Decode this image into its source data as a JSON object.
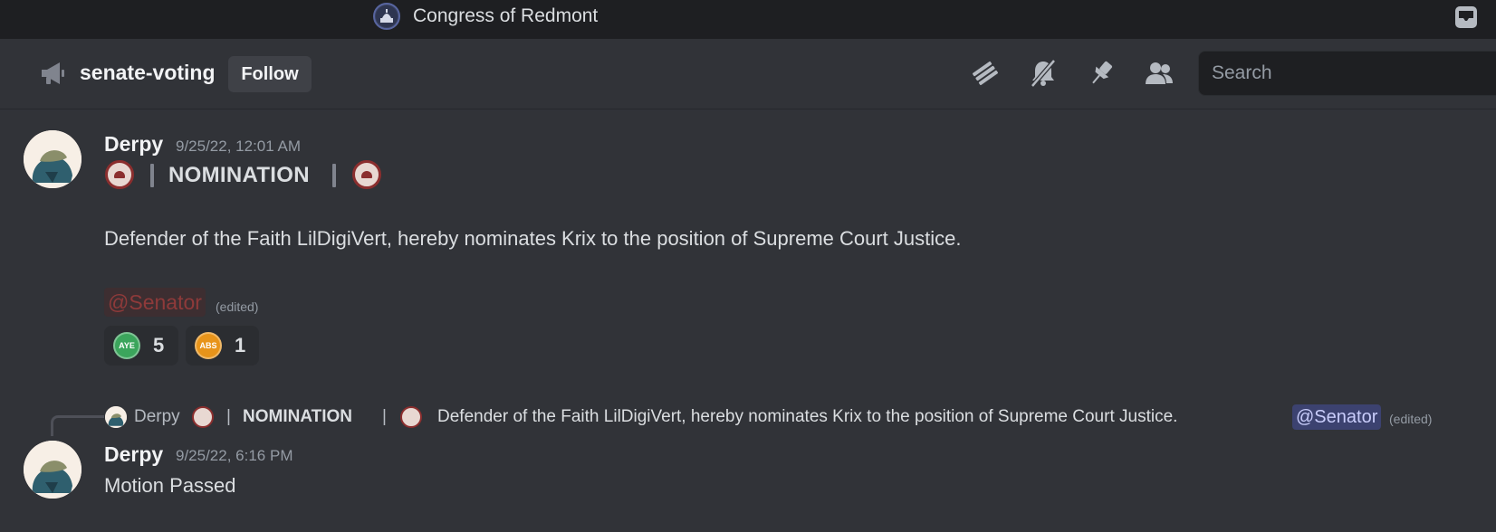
{
  "titlebar": {
    "server_name": "Congress of Redmont",
    "server_icon": "capitol-icon",
    "inbox_icon": "inbox-icon"
  },
  "channel": {
    "icon": "megaphone-icon",
    "name": "senate-voting",
    "follow_label": "Follow",
    "toolbar_icons": [
      "threads-icon",
      "notifications-muted-icon",
      "pin-icon",
      "members-icon"
    ],
    "search_placeholder": "Search"
  },
  "messages": [
    {
      "author": "Derpy",
      "timestamp": "9/25/22, 12:01 AM",
      "heading": "NOMINATION",
      "separator": "|",
      "body": "Defender of the Faith LilDigiVert, hereby nominates Krix to the position of Supreme Court Justice.",
      "mention": "@Senator",
      "edited": "(edited)",
      "reactions": [
        {
          "emoji_label": "AYE",
          "count": "5",
          "color": "#3ba55c"
        },
        {
          "emoji_label": "ABS",
          "count": "1",
          "color": "#e8941a"
        }
      ]
    },
    {
      "reply_preview": {
        "author": "Derpy",
        "heading": "NOMINATION",
        "separator": "|",
        "text": "Defender of the Faith LilDigiVert, hereby nominates Krix to the position of Supreme Court Justice.",
        "mention": "@Senator",
        "edited": "(edited)"
      },
      "author": "Derpy",
      "timestamp": "9/25/22, 6:16 PM",
      "body": "Motion Passed"
    }
  ]
}
